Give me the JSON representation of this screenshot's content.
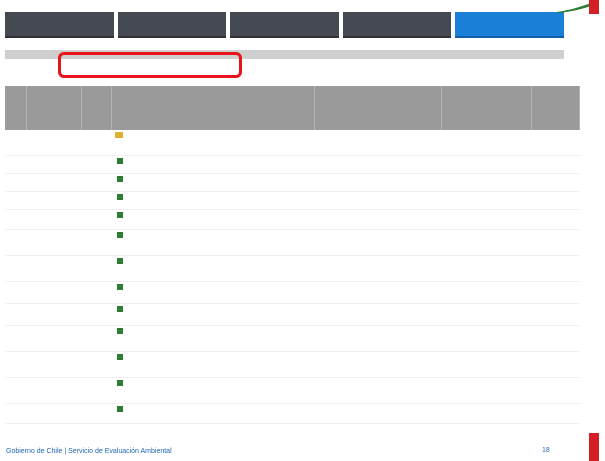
{
  "nav": {
    "tabs": [
      {
        "label": "",
        "active": false
      },
      {
        "label": "",
        "active": false
      },
      {
        "label": "",
        "active": false
      },
      {
        "label": "",
        "active": false
      },
      {
        "label": "",
        "active": true
      }
    ]
  },
  "links": {
    "primary": "",
    "secondary": ""
  },
  "table": {
    "headers": [
      "",
      "",
      "",
      "",
      "",
      "",
      ""
    ],
    "rows": [
      {
        "n": "",
        "date": "",
        "doc": "",
        "author": "",
        "dest": "",
        "time": ""
      },
      {
        "n": "",
        "date": "",
        "doc": "",
        "author": "",
        "dest": "",
        "time": ""
      },
      {
        "n": "",
        "date": "",
        "doc": "",
        "author": "",
        "dest": "",
        "time": ""
      },
      {
        "n": "",
        "date": "",
        "doc": "",
        "author": "",
        "dest": "",
        "time": ""
      },
      {
        "n": "",
        "date": "",
        "doc": "",
        "author": "",
        "dest": "",
        "time": ""
      },
      {
        "n": "",
        "date": "",
        "doc": "",
        "author": "",
        "dest": "",
        "time": ""
      },
      {
        "n": "",
        "date": "",
        "doc": "",
        "author": "",
        "dest": "",
        "time": ""
      },
      {
        "n": "",
        "date": "",
        "doc": "",
        "author": "",
        "dest": "",
        "time": ""
      },
      {
        "n": "",
        "date": "",
        "doc": "",
        "author": "",
        "dest": "",
        "time": ""
      },
      {
        "n": "",
        "date": "",
        "doc": "",
        "author": "",
        "dest": "",
        "time": ""
      },
      {
        "n": "",
        "date": "",
        "doc": "",
        "author": "",
        "dest": "",
        "time": ""
      },
      {
        "n": "",
        "date": "",
        "doc": "",
        "author": "",
        "dest": "",
        "time": ""
      },
      {
        "n": "",
        "date": "",
        "doc": "",
        "author": "",
        "dest": "",
        "time": ""
      }
    ]
  },
  "footer": {
    "text": "Gobierno de Chile | Servicio de Evaluación Ambiental",
    "page": "18"
  },
  "colors": {
    "highlight": "#e8141b",
    "nav_active": "#1a7fd6",
    "nav": "#454a52",
    "brand_red": "#d32026"
  }
}
